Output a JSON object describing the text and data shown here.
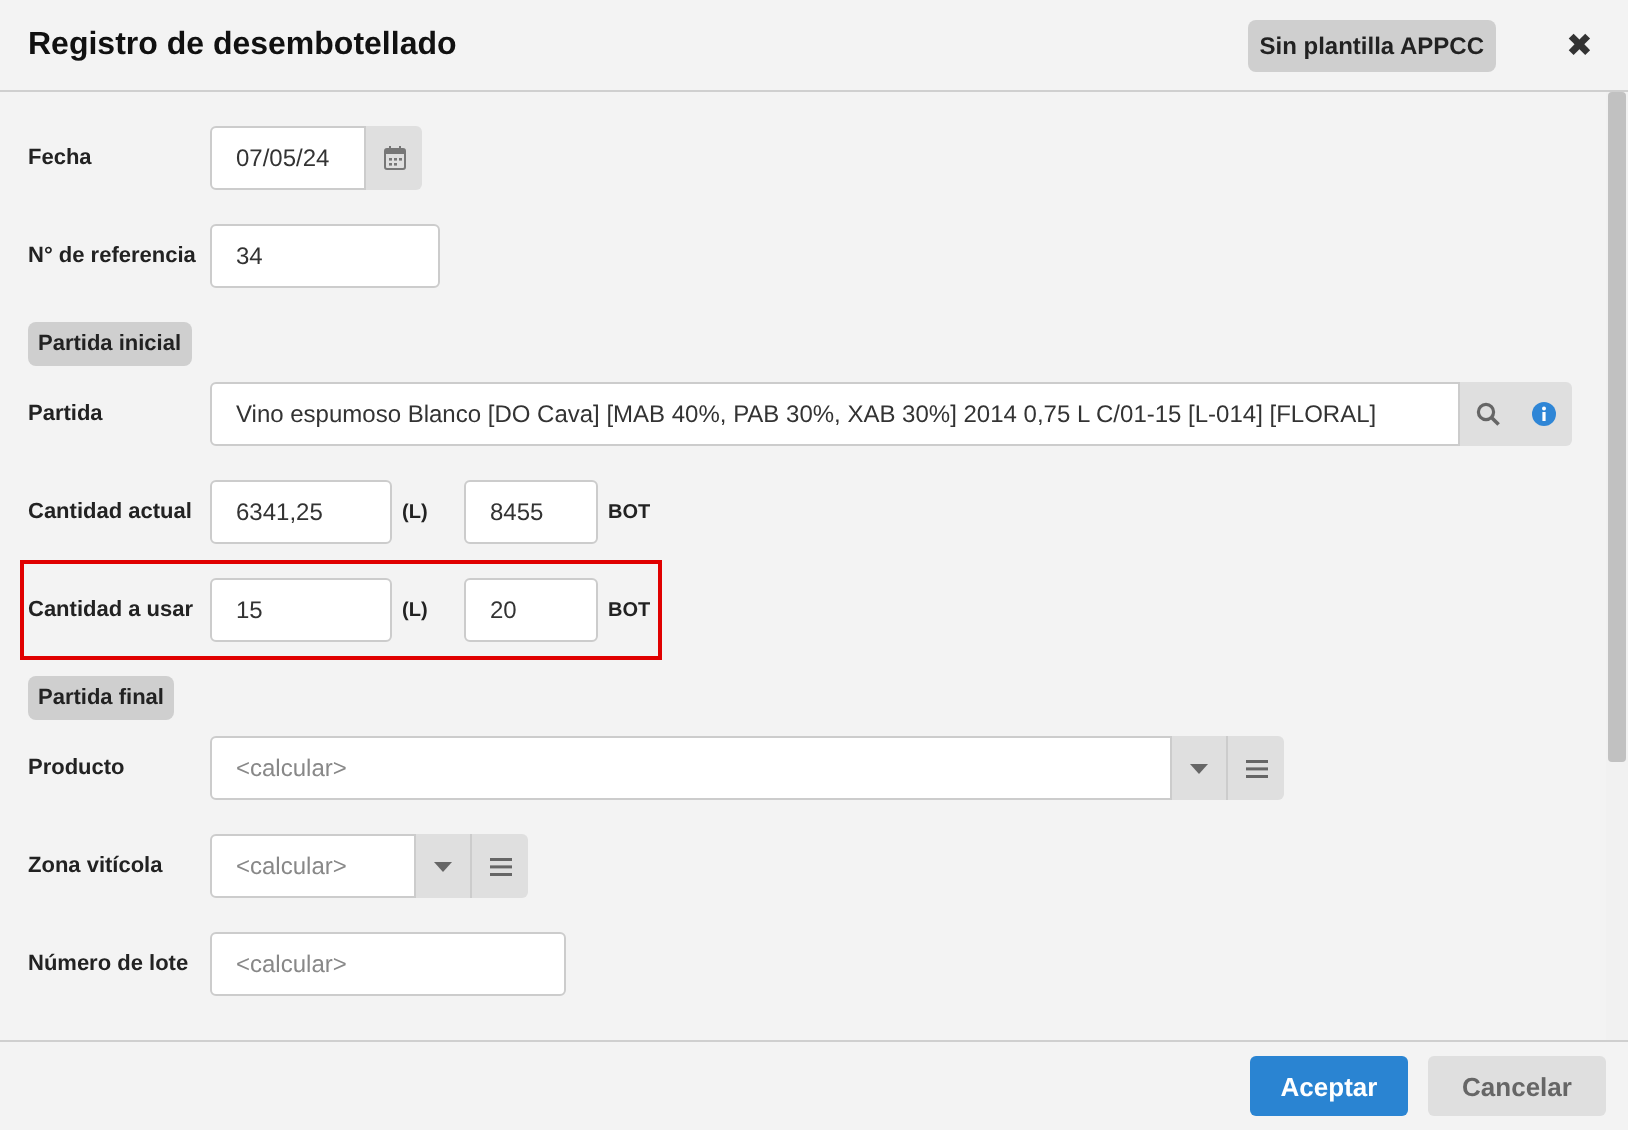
{
  "dialog": {
    "title": "Registro de desembotellado",
    "badge": "Sin plantilla APPCC",
    "close": "✖"
  },
  "rows": [
    {
      "kind": "date",
      "label": "Fecha",
      "value": "07/05/24"
    },
    {
      "kind": "shorttext",
      "label": "N° de referencia",
      "value": "34"
    },
    {
      "kind": "section",
      "label": "Partida inicial"
    },
    {
      "kind": "lookup",
      "label": "Partida",
      "value": "Vino espumoso Blanco [DO Cava] [MAB 40%, PAB 30%, XAB 30%] 2014 0,75 L C/01-15 [L-014] [FLORAL]"
    },
    {
      "kind": "quantity",
      "label": "Cantidad actual",
      "liters": "6341,25",
      "liters_unit": "(L)",
      "bottles": "8455",
      "bottles_unit": "BOT",
      "highlighted": false
    },
    {
      "kind": "quantity",
      "label": "Cantidad a usar",
      "liters": "15",
      "liters_unit": "(L)",
      "bottles": "20",
      "bottles_unit": "BOT",
      "highlighted": true
    },
    {
      "kind": "section",
      "label": "Partida final"
    },
    {
      "kind": "wideselect",
      "label": "Producto",
      "placeholder": "<calcular>"
    },
    {
      "kind": "select",
      "label": "Zona vitícola",
      "placeholder": "<calcular>"
    },
    {
      "kind": "text",
      "label": "Número de lote",
      "placeholder": "<calcular>"
    }
  ],
  "buttons": [
    {
      "label": "Aceptar",
      "primary": true
    },
    {
      "label": "Cancelar",
      "primary": false
    }
  ]
}
